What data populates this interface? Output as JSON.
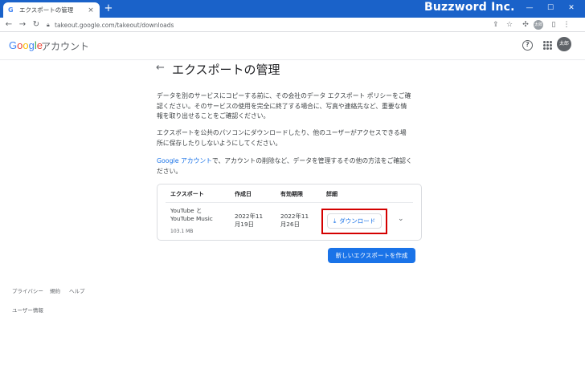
{
  "browser": {
    "tab_title": "エクスポートの管理",
    "tab_favicon": "G",
    "new_tab": "+",
    "close_tab": "×",
    "url": "takeout.google.com/takeout/downloads",
    "profile_label": "太郎"
  },
  "watermark": "Buzzword Inc.",
  "header": {
    "logo_letters": [
      "G",
      "o",
      "o",
      "g",
      "l",
      "e"
    ],
    "account_label": "アカウント",
    "avatar_label": "太郎"
  },
  "page": {
    "title": "エクスポートの管理",
    "para1_lines": [
      "データを別のサービスにコピーする前に、その会社のデータ エクスポート ポリシーをご確",
      "認ください。そのサービスの使用を完全に終了する場合に、写真や連絡先など、重要な情",
      "報を取り出せることをご確認ください。"
    ],
    "para2_lines": [
      "エクスポートを公共のパソコンにダウンロードしたり、他のユーザーがアクセスできる場",
      "所に保存したりしないようにしてください。"
    ],
    "para3_link": "Google アカウント",
    "para3_rest_line1": "で、アカウントの削除など、データを管理するその他の方法をご確認く",
    "para3_line2": "ださい。"
  },
  "export_table": {
    "headers": {
      "export": "エクスポート",
      "created": "作成日",
      "expires": "有効期限",
      "details": "詳細"
    },
    "row": {
      "name_line1": "YouTube と",
      "name_line2": "YouTube Music",
      "size": "103.1 MB",
      "created_line1": "2022年11",
      "created_line2": "月19日",
      "expires_line1": "2022年11",
      "expires_line2": "月26日",
      "download_label": "ダウンロード"
    }
  },
  "create_button": "新しいエクスポートを作成",
  "footer": {
    "links": [
      "プライバシー",
      "規約",
      "ヘルプ"
    ],
    "user_info": "ユーザー情報"
  },
  "colors": {
    "chrome_blue": "#1a62c9",
    "link_blue": "#1a73e8",
    "highlight_red": "#d40000"
  }
}
